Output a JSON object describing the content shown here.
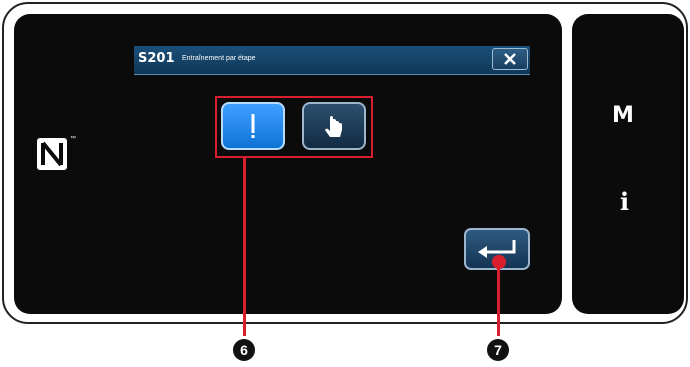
{
  "dialog": {
    "code": "S201",
    "title": "Entraînement par étape"
  },
  "modes": [
    {
      "name": "needle-step",
      "icon": "needle-icon",
      "selected": true
    },
    {
      "name": "touch-step",
      "icon": "pointer-hand-icon",
      "selected": false
    }
  ],
  "side_panel": {
    "m_label": "M",
    "info_label": "i"
  },
  "callouts": {
    "six": "❻",
    "seven": "❼"
  },
  "colors": {
    "screen_bg": "#0b0b0b",
    "title_bar": "#1c4f79",
    "selected_button": "#1a86f0",
    "callout": "#d91f2d"
  }
}
